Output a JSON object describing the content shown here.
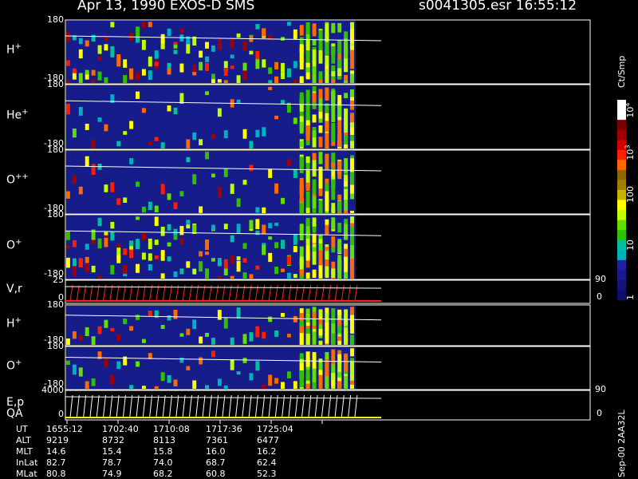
{
  "header": {
    "date_instrument": "Apr 13, 1990    EXOS-D SMS",
    "file_time": "s0041305.esr  16:55:12"
  },
  "panels": [
    {
      "label": "H",
      "sup": "+",
      "ymax": "180",
      "ymin": "-180"
    },
    {
      "label": "He",
      "sup": "+",
      "ymax": "180",
      "ymin": "-180"
    },
    {
      "label": "O",
      "sup": "++",
      "ymax": "180",
      "ymin": "-180"
    },
    {
      "label": "O",
      "sup": "+",
      "ymax": "180",
      "ymin": "-180"
    },
    {
      "label": "V,r",
      "sup": "",
      "ymax": "25",
      "ymin": "0",
      "right_max": "90",
      "right_min": "0"
    },
    {
      "label": "H",
      "sup": "+",
      "ymax": "180",
      "ymin": "-180"
    },
    {
      "label": "O",
      "sup": "+",
      "ymax": "180",
      "ymin": "-180"
    },
    {
      "label": "E,p",
      "label2": "QA",
      "sup": "",
      "ymax": "4000",
      "ymin": "0",
      "right_max": "90",
      "right_min": "0"
    }
  ],
  "colorbar": {
    "unit": "Ct/Smp",
    "ticks": [
      {
        "label": "10",
        "sup": "4"
      },
      {
        "label": "10",
        "sup": "3"
      },
      {
        "label": "100",
        "sup": ""
      },
      {
        "label": "10",
        "sup": ""
      },
      {
        "label": "1",
        "sup": ""
      }
    ],
    "colors": [
      "#ffffff",
      "#ffffff",
      "#7a0000",
      "#a00000",
      "#d00000",
      "#ff1e00",
      "#ff6a00",
      "#8a6a00",
      "#a08000",
      "#c8b400",
      "#ffff00",
      "#c0ff00",
      "#60e000",
      "#30c000",
      "#00c0a0",
      "#00b0c0",
      "#2020a0",
      "#1a1a8a",
      "#141478",
      "#0e0e6a"
    ]
  },
  "credit": "Sep-00  2AA32L",
  "footer": {
    "rows": [
      {
        "name": "UT",
        "values": [
          "1655:12",
          "1702:40",
          "1710:08",
          "1717:36",
          "1725:04"
        ]
      },
      {
        "name": "ALT",
        "values": [
          "9219",
          "8732",
          "8113",
          "7361",
          "6477"
        ]
      },
      {
        "name": "MLT",
        "values": [
          "14.6",
          "15.4",
          "15.8",
          "16.0",
          "16.2"
        ]
      },
      {
        "name": "InLat",
        "values": [
          "82.7",
          "78.7",
          "74.0",
          "68.7",
          "62.4"
        ]
      },
      {
        "name": "MLat",
        "values": [
          "80.8",
          "74.9",
          "68.2",
          "60.8",
          "52.3"
        ]
      }
    ]
  },
  "chart_data": {
    "type": "heatmap",
    "title": "Apr 13, 1990    EXOS-D SMS",
    "x_tick_labels": [
      "1655:12",
      "1702:40",
      "1710:08",
      "1717:36",
      "1725:04"
    ],
    "y_range": [
      -180,
      180
    ],
    "color_scale": "log",
    "color_range": [
      1,
      10000
    ],
    "color_unit": "Ct/Smp",
    "series": [
      {
        "name": "H+",
        "panel": 0
      },
      {
        "name": "He+",
        "panel": 1
      },
      {
        "name": "O++",
        "panel": 2
      },
      {
        "name": "O+",
        "panel": 3
      },
      {
        "name": "V,r",
        "panel": 4,
        "ylim": [
          0,
          25
        ],
        "y2lim": [
          0,
          90
        ]
      },
      {
        "name": "H+",
        "panel": 5
      },
      {
        "name": "O+",
        "panel": 6
      },
      {
        "name": "E,p QA",
        "panel": 7,
        "ylim": [
          0,
          4000
        ],
        "y2lim": [
          0,
          90
        ]
      }
    ]
  }
}
